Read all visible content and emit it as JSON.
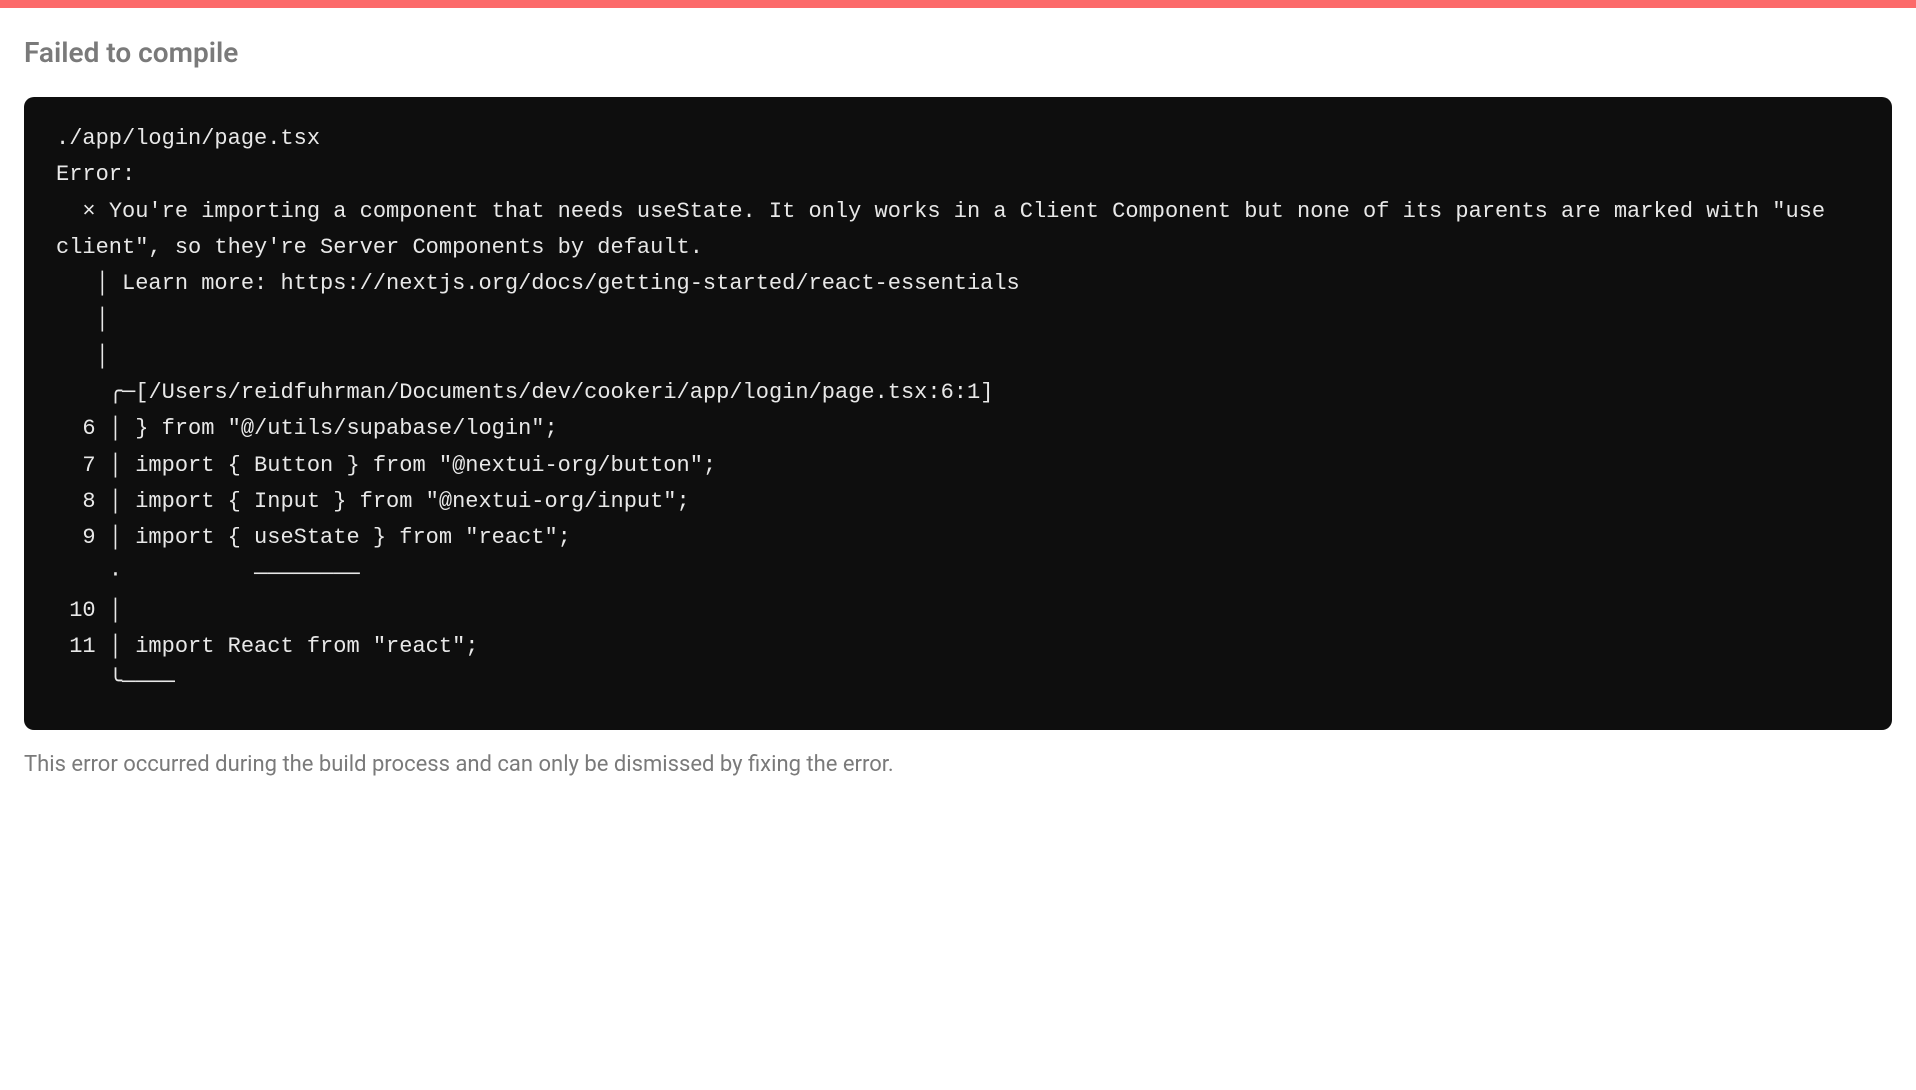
{
  "title": "Failed to compile",
  "error": {
    "file": "./app/login/page.tsx",
    "label": "Error:",
    "message_prefix": "  × ",
    "message": "You're importing a component that needs useState. It only works in a Client Component but none of its parents are marked with \"use client\", so they're Server Components by default.",
    "learn_more_line": "   │ Learn more: https://nextjs.org/docs/getting-started/react-essentials",
    "pipe_line1": "   │ ",
    "pipe_line2": "   │ ",
    "source_header": "    ╭─[/Users/reidfuhrman/Documents/dev/cookeri/app/login/page.tsx:6:1]",
    "line6": "  6 │ } from \"@/utils/supabase/login\";",
    "line7": "  7 │ import { Button } from \"@nextui-org/button\";",
    "line8": "  8 │ import { Input } from \"@nextui-org/input\";",
    "line9": "  9 │ import { useState } from \"react\";",
    "underline": "    ·          ────────",
    "line10": " 10 │ ",
    "line11": " 11 │ import React from \"react\";",
    "closer": "    ╰────"
  },
  "footer": "This error occurred during the build process and can only be dismissed by fixing the error."
}
